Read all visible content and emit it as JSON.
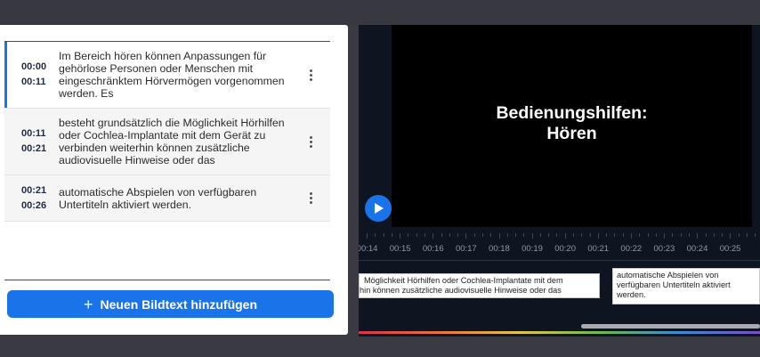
{
  "subtitle_list": {
    "rows": [
      {
        "start": "00:00",
        "end": "00:11",
        "text": "Im Bereich hören können Anpassungen für gehörlose Personen oder Menschen mit eingeschränktem Hörvermögen vorgenommen werden. Es"
      },
      {
        "start": "00:11",
        "end": "00:21",
        "text": "besteht grundsätzlich die Möglichkeit Hörhilfen oder Cochlea-Implantate mit dem Gerät zu verbinden weiterhin können zusätzliche audiovisuelle Hinweise oder das"
      },
      {
        "start": "00:21",
        "end": "00:26",
        "text": "automatische Abspielen von verfügbaren Untertiteln aktiviert werden."
      }
    ],
    "row_menu_icon": "more-vert-icon",
    "add_button": {
      "icon": "plus-icon",
      "plus_glyph": "+",
      "label": "Neuen Bildtext hinzufügen"
    }
  },
  "player": {
    "video_title": "Bedienungshilfen:\nHören",
    "play_icon": "play-icon",
    "timeline_labels": [
      "00:14",
      "00:15",
      "00:16",
      "00:17",
      "00:18",
      "00:19",
      "00:20",
      "00:21",
      "00:22",
      "00:23",
      "00:24",
      "00:25"
    ],
    "timeline_captions": [
      {
        "line1": "Möglichkeit Hörhilfen oder Cochlea-Implantate mit dem",
        "line2": "rhin können zusätzliche audiovisuelle Hinweise oder das"
      },
      {
        "text": "automatische Abspielen von verfügbaren Untertiteln aktiviert werden."
      }
    ]
  },
  "colors": {
    "accent": "#1a73e8",
    "background": "#3a3b42",
    "editor_background": "#0e1520"
  }
}
